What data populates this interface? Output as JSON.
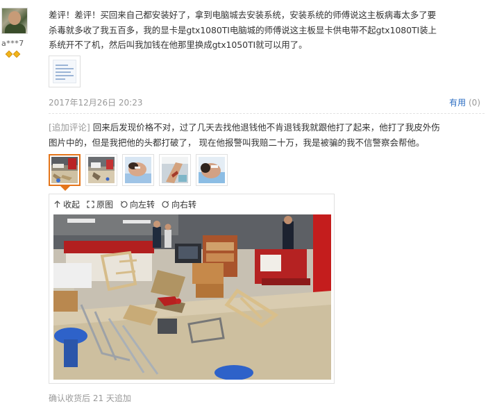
{
  "user": {
    "name": "a***7",
    "level_icons": [
      "diamond-icon",
      "diamond-icon"
    ],
    "level_color": "#f1b41a"
  },
  "review": {
    "lines": [
      "差评！差评！买回来自己都安装好了，拿到电脑城去安装系统，安装系统的师傅说这主板病毒太多了要",
      "杀毒就多收了我五百多，我的显卡是gtx1080TI电脑城的师傅说这主板显卡供电带不起gtx1080TI装上",
      "系统开不了机，然后叫我加钱在他那里换成gtx1050TI就可以用了。"
    ],
    "date": "2017年12月26日 20:23",
    "useful_label": "有用",
    "useful_count": "(0)"
  },
  "append": {
    "tag": "[追加评论]",
    "lines": [
      " 回来后发现价格不对，过了几天去找他退钱他不肯退钱我就跟他打了起来，他打了我皮外伤",
      "图片中的，但是我把他的头都打破了， 现在他报警叫我赔二十万，我是被骗的我不信警察会帮他。"
    ],
    "toolbar": {
      "collapse": "收起",
      "original": "原图",
      "rotate_left": "向左转",
      "rotate_right": "向右转"
    },
    "footer": "确认收货后 21 天追加"
  },
  "colors": {
    "accent": "#e4751a",
    "link": "#2a6cc2",
    "muted": "#999999"
  }
}
